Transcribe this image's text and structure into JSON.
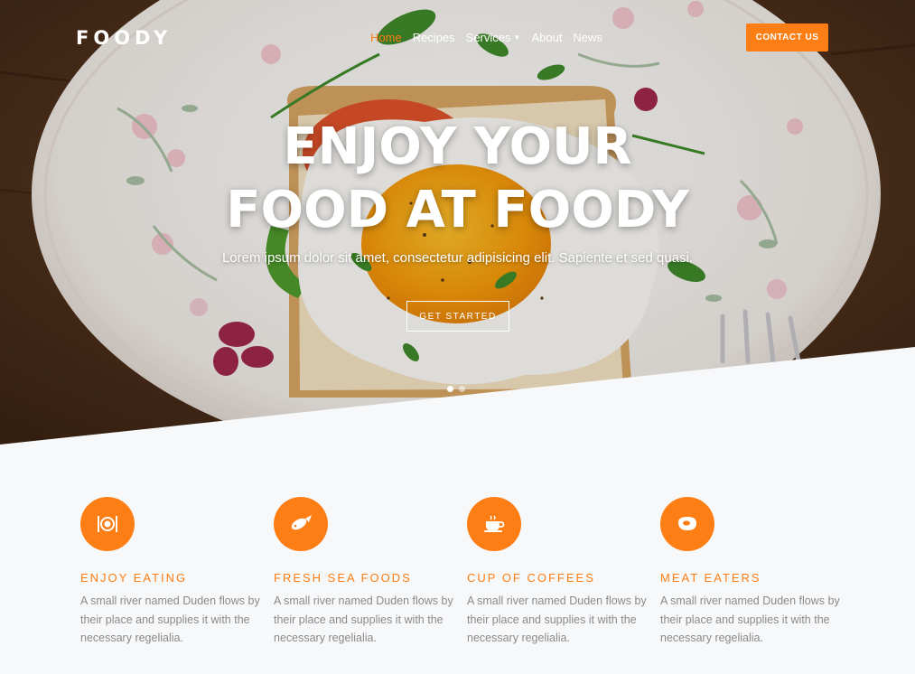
{
  "brand": {
    "name": "FOODY"
  },
  "nav": {
    "items": [
      {
        "label": "Home",
        "active": true
      },
      {
        "label": "Recipes",
        "active": false
      },
      {
        "label": "Services",
        "active": false,
        "dropdown": true
      },
      {
        "label": "About",
        "active": false
      },
      {
        "label": "News",
        "active": false
      }
    ],
    "caret_glyph": "▼"
  },
  "header": {
    "contact_label": "CONTACT US"
  },
  "hero": {
    "title_line1": "ENJOY YOUR",
    "title_line2": "FOOD AT FOODY",
    "subtitle": "Lorem ipsum dolor sit amet, consectetur adipisicing elit. Sapiente et sed quasi.",
    "cta_label": "GET STARTED",
    "slides_total": 2,
    "slide_active": 1
  },
  "features": [
    {
      "icon": "cutlery-icon",
      "title": "ENJOY EATING",
      "text": "A small river named Duden flows by their place and supplies it with the necessary regelialia."
    },
    {
      "icon": "fish-icon",
      "title": "FRESH SEA FOODS",
      "text": "A small river named Duden flows by their place and supplies it with the necessary regelialia."
    },
    {
      "icon": "coffee-cup-icon",
      "title": "CUP OF COFFEES",
      "text": "A small river named Duden flows by their place and supplies it with the necessary regelialia."
    },
    {
      "icon": "meat-icon",
      "title": "MEAT EATERS",
      "text": "A small river named Duden flows by their place and supplies it with the necessary regelialia."
    }
  ],
  "colors": {
    "accent": "#fd7e14",
    "background": "#f7f8fa",
    "muted_text": "#8a8a8a"
  }
}
